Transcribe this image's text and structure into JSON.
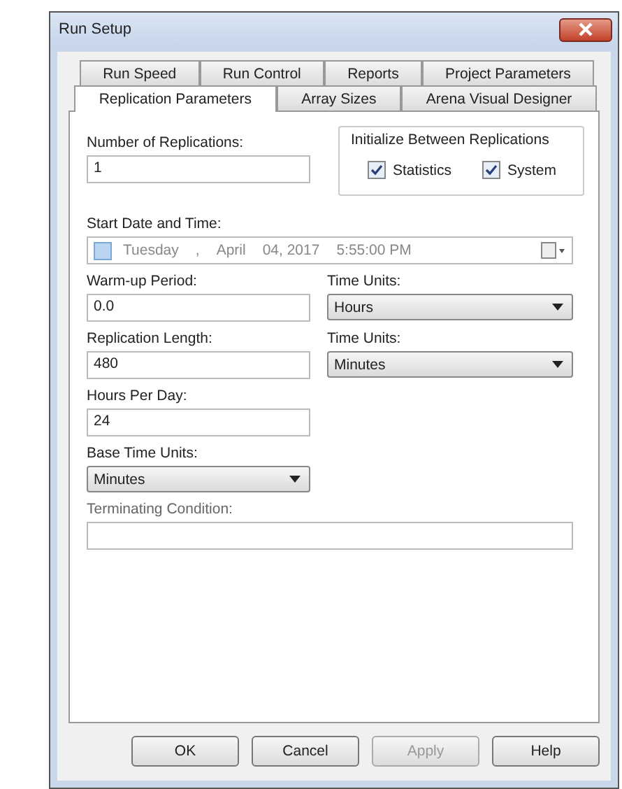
{
  "window": {
    "title": "Run Setup"
  },
  "tabs_back_row": [
    {
      "label": "Run Speed",
      "selected": false
    },
    {
      "label": "Run Control",
      "selected": false
    },
    {
      "label": "Reports",
      "selected": false
    },
    {
      "label": "Project Parameters",
      "selected": false
    }
  ],
  "tabs_front_row": [
    {
      "label": "Replication Parameters",
      "selected": true
    },
    {
      "label": "Array Sizes",
      "selected": false
    },
    {
      "label": "Arena Visual Designer",
      "selected": false
    }
  ],
  "replications": {
    "label": "Number of Replications:",
    "value": "1"
  },
  "initialize_group": {
    "title": "Initialize Between Replications",
    "options": [
      {
        "label": "Statistics",
        "checked": true
      },
      {
        "label": "System",
        "checked": true
      }
    ]
  },
  "start_date": {
    "label": "Start Date and Time:",
    "checked": false,
    "day": "Tuesday",
    "sep": ",",
    "month": "April",
    "date": "04, 2017",
    "time": "5:55:00 PM"
  },
  "warmup": {
    "label": "Warm-up Period:",
    "value": "0.0",
    "units_label": "Time Units:",
    "units": "Hours"
  },
  "replication_length": {
    "label": "Replication Length:",
    "value": "480",
    "units_label": "Time Units:",
    "units": "Minutes"
  },
  "hours_per_day": {
    "label": "Hours Per Day:",
    "value": "24"
  },
  "base_time_units": {
    "label": "Base Time Units:",
    "value": "Minutes"
  },
  "terminating_condition": {
    "label": "Terminating Condition:"
  },
  "buttons": [
    {
      "label": "OK",
      "disabled": false
    },
    {
      "label": "Cancel",
      "disabled": false
    },
    {
      "label": "Apply",
      "disabled": true
    },
    {
      "label": "Help",
      "disabled": false
    }
  ]
}
